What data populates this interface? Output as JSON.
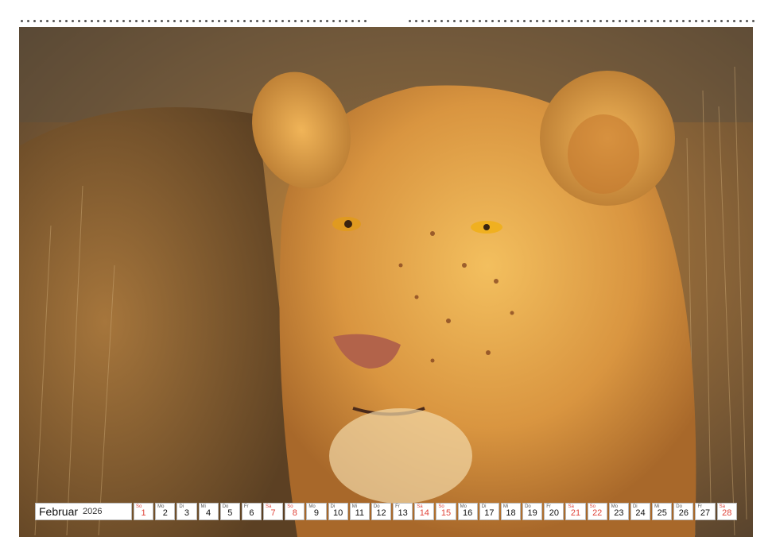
{
  "calendar": {
    "month": "Februar",
    "year": "2026",
    "days": [
      {
        "wd": "So",
        "d": "1",
        "weekend": true
      },
      {
        "wd": "Mo",
        "d": "2",
        "weekend": false
      },
      {
        "wd": "Di",
        "d": "3",
        "weekend": false
      },
      {
        "wd": "Mi",
        "d": "4",
        "weekend": false
      },
      {
        "wd": "Do",
        "d": "5",
        "weekend": false
      },
      {
        "wd": "Fr",
        "d": "6",
        "weekend": false
      },
      {
        "wd": "Sa",
        "d": "7",
        "weekend": true
      },
      {
        "wd": "So",
        "d": "8",
        "weekend": true
      },
      {
        "wd": "Mo",
        "d": "9",
        "weekend": false
      },
      {
        "wd": "Di",
        "d": "10",
        "weekend": false
      },
      {
        "wd": "Mi",
        "d": "11",
        "weekend": false
      },
      {
        "wd": "Do",
        "d": "12",
        "weekend": false
      },
      {
        "wd": "Fr",
        "d": "13",
        "weekend": false
      },
      {
        "wd": "Sa",
        "d": "14",
        "weekend": true
      },
      {
        "wd": "So",
        "d": "15",
        "weekend": true
      },
      {
        "wd": "Mo",
        "d": "16",
        "weekend": false
      },
      {
        "wd": "Di",
        "d": "17",
        "weekend": false
      },
      {
        "wd": "Mi",
        "d": "18",
        "weekend": false
      },
      {
        "wd": "Do",
        "d": "19",
        "weekend": false
      },
      {
        "wd": "Fr",
        "d": "20",
        "weekend": false
      },
      {
        "wd": "Sa",
        "d": "21",
        "weekend": true
      },
      {
        "wd": "So",
        "d": "22",
        "weekend": true
      },
      {
        "wd": "Mo",
        "d": "23",
        "weekend": false
      },
      {
        "wd": "Di",
        "d": "24",
        "weekend": false
      },
      {
        "wd": "Mi",
        "d": "25",
        "weekend": false
      },
      {
        "wd": "Do",
        "d": "26",
        "weekend": false
      },
      {
        "wd": "Fr",
        "d": "27",
        "weekend": false
      },
      {
        "wd": "Sa",
        "d": "28",
        "weekend": true
      }
    ]
  },
  "colors": {
    "weekend": "#e0443a",
    "lion_fur": "#d9a24a",
    "background_grass": "#8a6a3a"
  }
}
